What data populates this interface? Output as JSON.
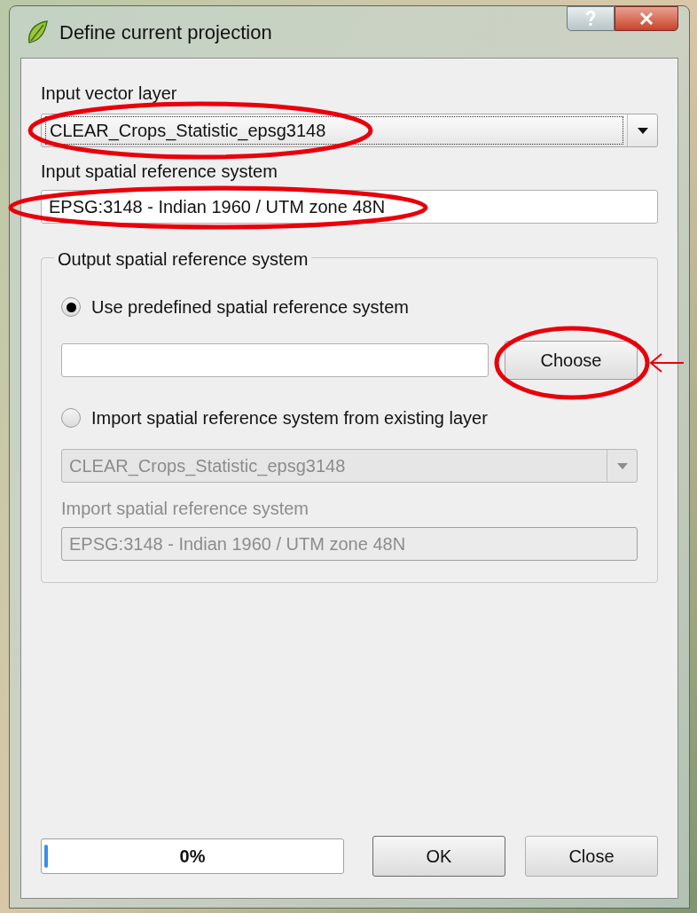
{
  "window": {
    "title": "Define current projection"
  },
  "input_layer": {
    "label": "Input vector layer",
    "value": "CLEAR_Crops_Statistic_epsg3148"
  },
  "input_crs": {
    "label": "Input spatial reference system",
    "value": "EPSG:3148 - Indian 1960 / UTM zone 48N"
  },
  "output_group": {
    "title": "Output spatial reference system",
    "options": [
      {
        "label": "Use predefined spatial reference system",
        "selected": true
      },
      {
        "label": "Import spatial reference system from existing layer",
        "selected": false
      }
    ],
    "predefined_field": {
      "button": "Choose"
    },
    "import_layer": {
      "value": "CLEAR_Crops_Statistic_epsg3148",
      "disabled": true
    },
    "import_crs": {
      "label": "Import spatial reference system",
      "value": "EPSG:3148 - Indian 1960 / UTM zone 48N",
      "disabled": true
    }
  },
  "progress": {
    "level": 0,
    "text": "0%"
  },
  "buttons": [
    "OK",
    "Close"
  ]
}
